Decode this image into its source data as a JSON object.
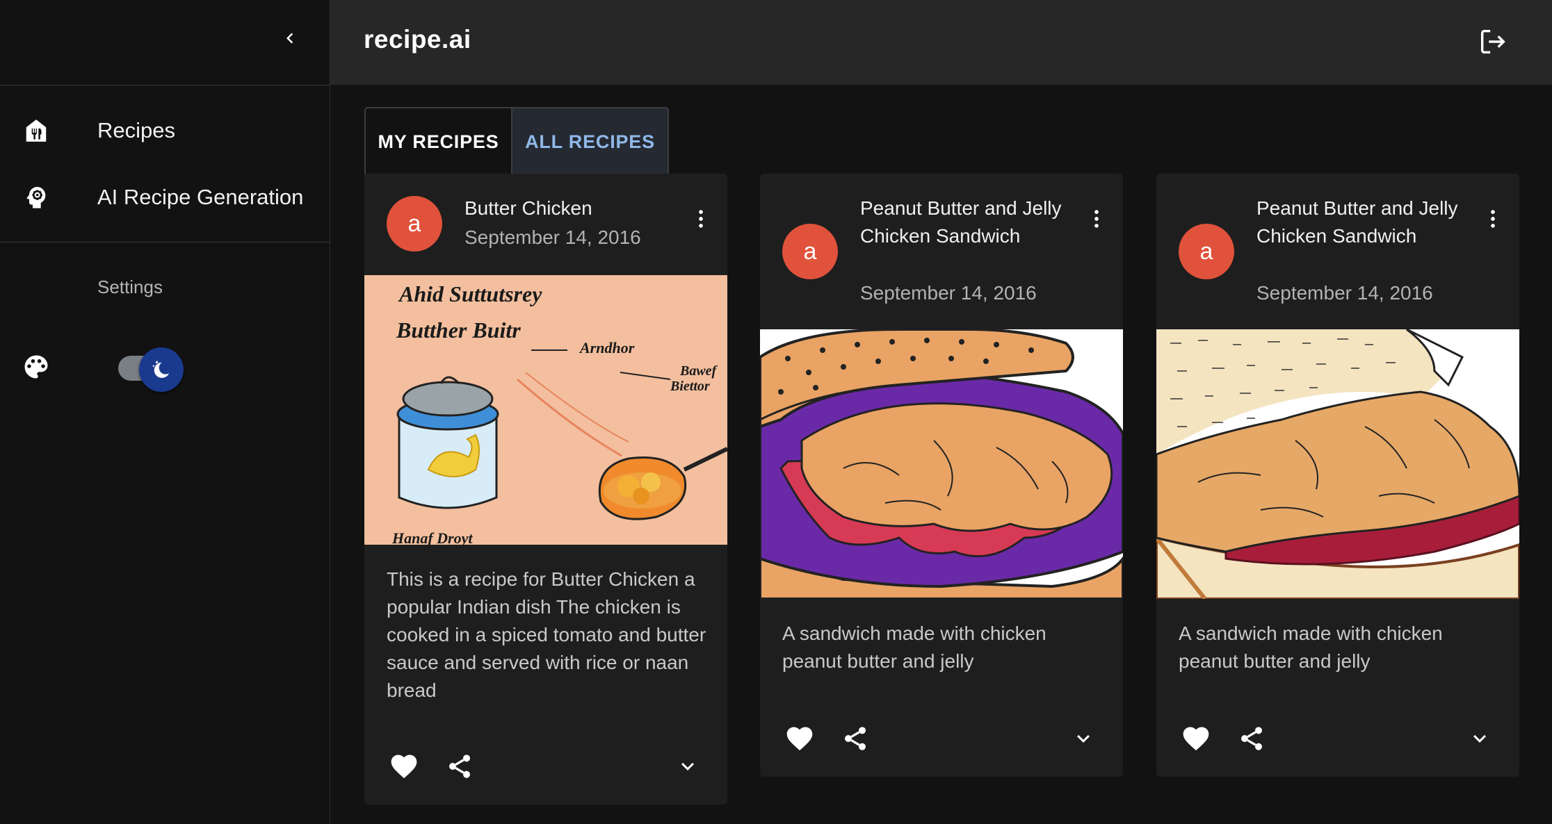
{
  "app": {
    "title": "recipe.ai"
  },
  "sidebar": {
    "items": [
      {
        "label": "Recipes",
        "icon": "restaurant-icon"
      },
      {
        "label": "AI Recipe Generation",
        "icon": "ai-brain-icon"
      }
    ],
    "settings_label": "Settings",
    "theme_toggle": {
      "state": "dark",
      "icon": "palette-icon"
    }
  },
  "tabs": [
    {
      "label": "MY RECIPES",
      "active": false
    },
    {
      "label": "ALL RECIPES",
      "active": true
    }
  ],
  "cards": [
    {
      "avatar": "a",
      "title": "Butter Chicken",
      "date": "September 14, 2016",
      "image_text": [
        "Ahid Suttutsrey",
        "Butther Buitr",
        "Arndhor",
        "Bawef",
        "Biettor",
        "Hanaf Droyt"
      ],
      "description": "This is a recipe for Butter Chicken a popular Indian dish The chicken is cooked in a spiced tomato and butter sauce and served with rice or naan bread"
    },
    {
      "avatar": "a",
      "title": "Peanut Butter and Jelly Chicken Sandwich",
      "date": "September 14, 2016",
      "description": "A sandwich made with chicken peanut butter and jelly"
    },
    {
      "avatar": "a",
      "title": "Peanut Butter and Jelly Chicken Sandwich",
      "date": "September 14, 2016",
      "description": "A sandwich made with chicken peanut butter and jelly"
    }
  ],
  "colors": {
    "avatar": "#e0523b",
    "active_tab_text": "#90b8e8",
    "topbar": "#272727",
    "card": "#1e1e1e"
  }
}
